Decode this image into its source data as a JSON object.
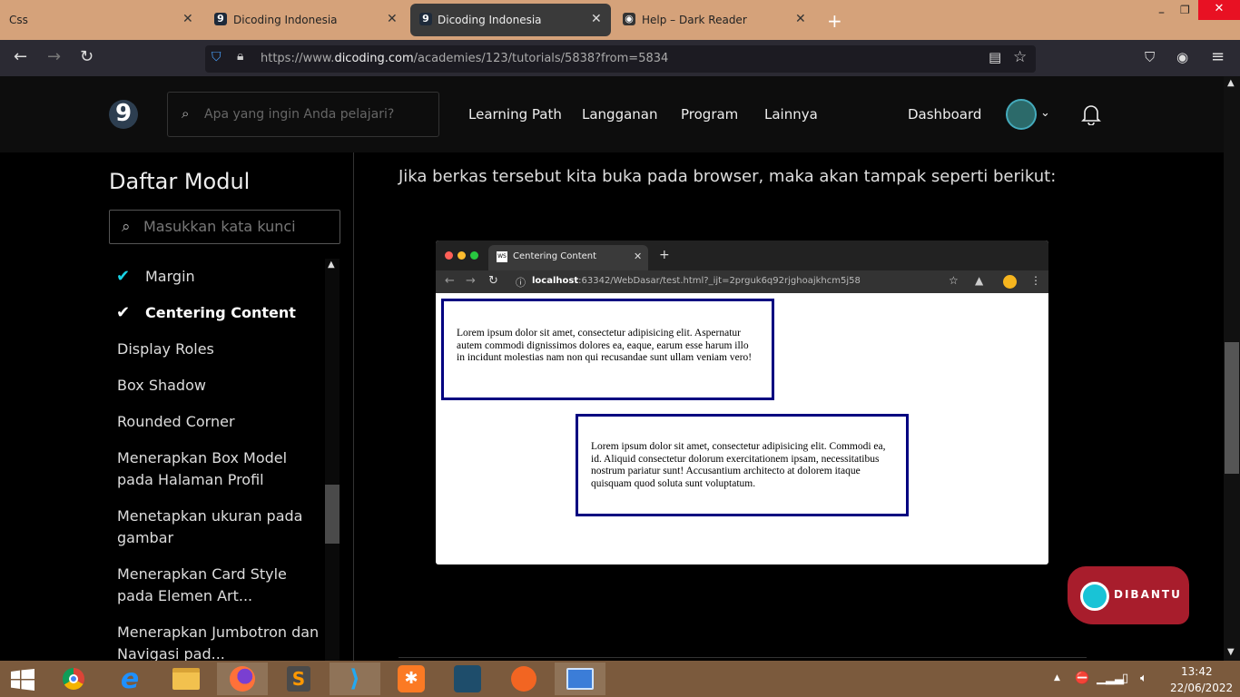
{
  "browser": {
    "tabs": [
      {
        "title": "Css"
      },
      {
        "title": "Dicoding Indonesia"
      },
      {
        "title": "Dicoding Indonesia",
        "active": true
      },
      {
        "title": "Help – Dark Reader"
      }
    ],
    "url_prefix": "https://www.",
    "url_domain": "dicoding.com",
    "url_path": "/academies/123/tutorials/5838?from=5834",
    "window_controls": [
      "–",
      "❐",
      "✕"
    ],
    "new_tab": "+"
  },
  "site": {
    "logo_letter": "9",
    "search_placeholder": "Apa yang ingin Anda pelajari?",
    "menu": [
      "Learning Path",
      "Langganan",
      "Program",
      "Lainnya"
    ],
    "dashboard": "Dashboard"
  },
  "sidebar": {
    "title": "Daftar Modul",
    "search_placeholder": "Masukkan kata kunci",
    "items": [
      {
        "label": "Margin",
        "done": true
      },
      {
        "label": "Centering Content",
        "done": true
      },
      {
        "label": "Display Roles"
      },
      {
        "label": "Box Shadow"
      },
      {
        "label": "Rounded Corner"
      },
      {
        "label": "Menerapkan Box Model pada Halaman Profil"
      },
      {
        "label": "Menetapkan ukuran pada gambar"
      },
      {
        "label": "Menerapkan Card Style pada Elemen Art..."
      },
      {
        "label": "Menerapkan Jumbotron dan Navigasi pad..."
      }
    ]
  },
  "content": {
    "intro": "Jika berkas tersebut kita buka pada browser, maka akan tampak seperti berikut:",
    "shot": {
      "tab_title": "Centering Content",
      "tab_icon": "WS",
      "url_host": "localhost",
      "url_rest": ":63342/WebDasar/test.html?_ijt=2prguk6q92rjghoajkhcm5j58",
      "box1": "Lorem ipsum dolor sit amet, consectetur adipisicing elit. Aspernatur autem commodi dignissimos dolores ea, eaque, earum esse harum illo in incidunt molestias nam non qui recusandae sunt ullam veniam vero!",
      "box2": "Lorem ipsum dolor sit amet, consectetur adipisicing elit. Commodi ea, id. Aliquid consectetur dolorum exercitationem ipsam, necessitatibus nostrum pariatur sunt! Accusantium architecto at dolorem itaque quisquam quod soluta sunt voluptatum."
    }
  },
  "chat": {
    "label": "DIBANTU"
  },
  "taskbar": {
    "time": "13:42",
    "date": "22/06/2022"
  },
  "colors": {
    "accent": "#19d3e5",
    "chat": "#a81d2c",
    "box_border": "#000080"
  }
}
